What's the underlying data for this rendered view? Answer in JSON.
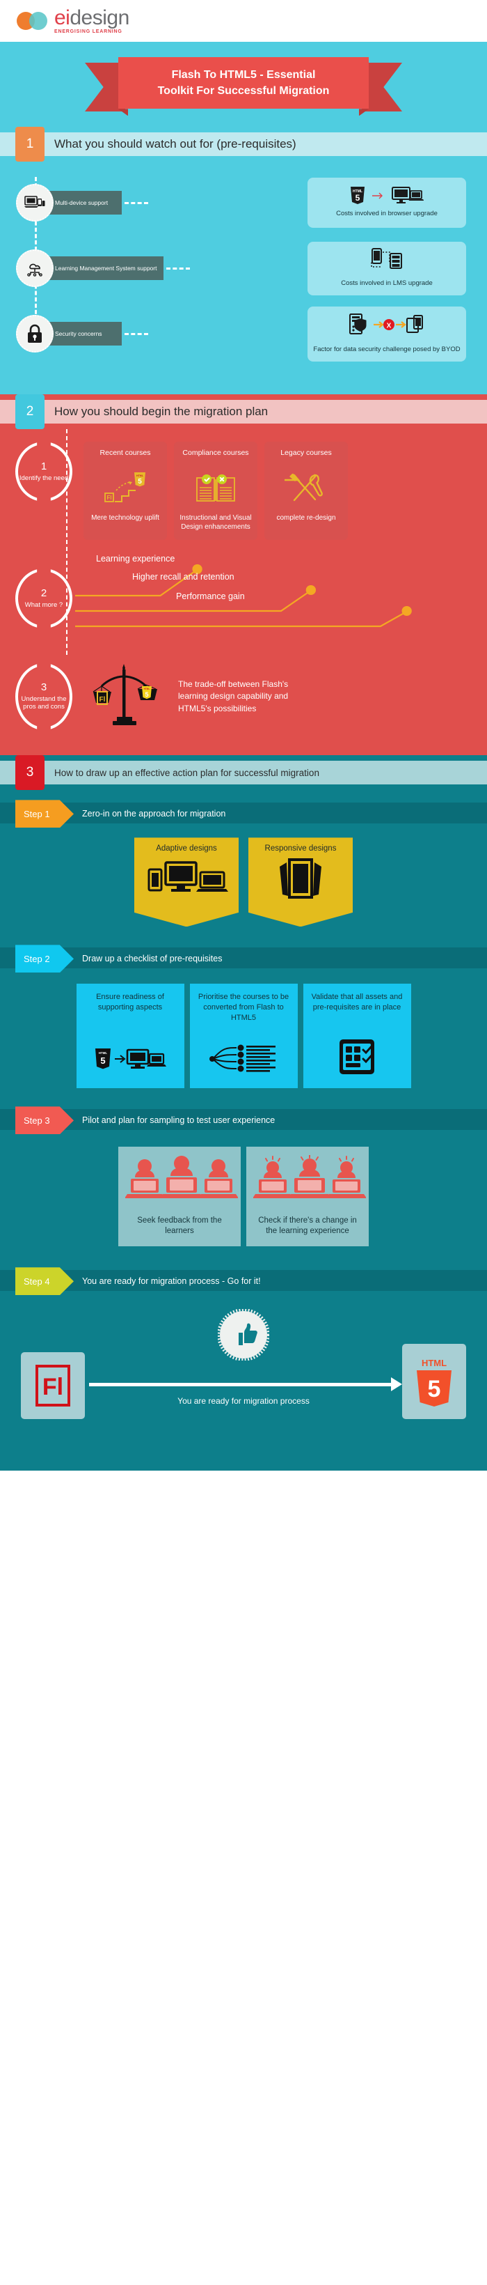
{
  "brand": {
    "name": "eidesign",
    "name_prefix": "ei",
    "name_suffix": "design",
    "tagline": "ENERGISING LEARNING",
    "accent_orange": "#ef7d2e",
    "accent_teal": "#5bc6c8",
    "accent_red": "#e0404a"
  },
  "banner": {
    "line1": "Flash To HTML5 - Essential",
    "line2": "Toolkit For Successful Migration",
    "bg": "#4fcde0",
    "ribbon_color": "#ea4f4b"
  },
  "section1": {
    "number": "1",
    "title": "What you should watch out for (pre-requisites)",
    "number_color": "#ee8c4b",
    "bg": "#4fcde0",
    "rows": [
      {
        "icon": "multi-device-icon",
        "label": "Multi-device support",
        "panel_icon": "html5-to-devices-icon",
        "panel_caption": "Costs involved in browser upgrade"
      },
      {
        "icon": "cloud-lms-icon",
        "label": "Learning Management System support",
        "panel_icon": "mobile-to-server-icon",
        "panel_caption": "Costs involved in LMS upgrade"
      },
      {
        "icon": "padlock-icon",
        "label": "Security concerns",
        "panel_icon": "server-shield-blocked-devices-icon",
        "panel_caption": "Factor for data security challenge posed by BYOD"
      }
    ]
  },
  "section2": {
    "number": "2",
    "title": "How you should begin the migration plan",
    "number_color": "#42c8de",
    "bg": "#e04f4c",
    "step1": {
      "ring_number": "1",
      "ring_caption": "Identify the need",
      "cards": [
        {
          "title": "Recent courses",
          "icon": "flash-stairs-html5-icon",
          "bottom": "Mere technology uplift"
        },
        {
          "title": "Compliance courses",
          "icon": "open-book-check-cross-icon",
          "bottom": "Instructional and Visual Design enhancements"
        },
        {
          "title": "Legacy courses",
          "icon": "wrench-screwdriver-icon",
          "bottom": "complete re-design"
        }
      ]
    },
    "step2": {
      "ring_number": "2",
      "ring_caption": "What more ?",
      "branches": [
        "Learning experience",
        "Higher recall and retention",
        "Performance gain"
      ],
      "branch_dot_color": "#f4a823"
    },
    "step3": {
      "ring_number": "3",
      "ring_caption": "Understand the pros and cons",
      "icon": "balance-scales-flash-html5-icon",
      "text": "The trade-off between Flash's learning design capability and HTML5's possibilities"
    }
  },
  "section3": {
    "number": "3",
    "title": "How to draw up an effective action plan for successful migration",
    "number_color": "#d91a25",
    "bg": "#0d7f8b",
    "steps": [
      {
        "tag": "Step 1",
        "tag_color": "#f59d20",
        "title": "Zero-in on the approach for migration",
        "cards": [
          {
            "title": "Adaptive designs",
            "icon": "adaptive-devices-icon"
          },
          {
            "title": "Responsive designs",
            "icon": "responsive-device-icon"
          }
        ]
      },
      {
        "tag": "Step 2",
        "tag_color": "#10c8ef",
        "title": "Draw up a checklist of pre-requisites",
        "cards": [
          {
            "title": "Ensure readiness of supporting aspects",
            "icon": "html5-to-devices-icon"
          },
          {
            "title": "Prioritise the courses to be converted from Flash to HTML5",
            "icon": "checklist-flow-icon"
          },
          {
            "title": "Validate that all assets and pre-requisites are in place",
            "icon": "tablet-checklist-icon"
          }
        ]
      },
      {
        "tag": "Step 3",
        "tag_color": "#f15a52",
        "title": "Pilot and plan for sampling to test user experience",
        "cards": [
          {
            "title": "Seek feedback from the learners",
            "icon": "three-learners-laptops-icon"
          },
          {
            "title": "Check if there's a change in the learning experience",
            "icon": "three-learners-idea-icon"
          }
        ]
      },
      {
        "tag": "Step 4",
        "tag_color": "#ccd42a",
        "title": "You are ready for migration process - Go for it!",
        "final": {
          "badge_icon": "thumbs-up-icon",
          "from_label": "Fl",
          "to_label_top": "HTML",
          "to_label_num": "5",
          "caption": "You are ready for migration process"
        }
      }
    ]
  }
}
